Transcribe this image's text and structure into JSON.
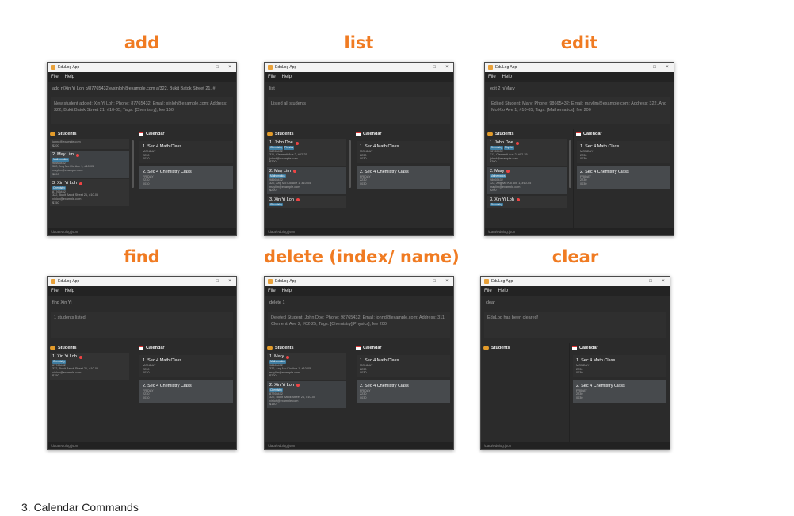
{
  "footer_text": "3. Calendar Commands",
  "accent_color": "#f07b22",
  "panels": [
    {
      "heading": "add",
      "window_title": "EduLog App",
      "menu": [
        "File",
        "Help"
      ],
      "command": "add n/Xin Yi Loh p/87765432 e/xinloh@example.com a/322, Bukit Batok Street 21, #",
      "result": "New student added: Xin Yi Loh; Phone: 87765432; Email: xinloh@example.com; Address: 322, Bukit Batok Street 21, #10-05; Tags: [Chemistry]; fee 150",
      "students_label": "Students",
      "calendar_label": "Calendar",
      "students": [
        {
          "partial": true,
          "lines": [
            "johnd@example.com",
            "$200"
          ]
        },
        {
          "name": "2. May Lim",
          "tags": [
            "Mathematics"
          ],
          "lines": [
            "98665432",
            "322, Ang Mo Kio Ave 1, #10-05",
            "maylim@example.com",
            "$200"
          ]
        },
        {
          "name": "3. Xin Yi Loh",
          "tags": [
            "Chemistry"
          ],
          "lines": [
            "87765432",
            "322, Bukit Batok Street 21, #10-05",
            "xinloh@example.com",
            "$150"
          ]
        }
      ],
      "classes": [
        {
          "name": "1. Sec 4 Math Class",
          "lines": [
            "MONDAY",
            "2230",
            "0030"
          ]
        },
        {
          "name": "2. Sec 4 Chemistry Class",
          "lines": [
            "FRIDAY",
            "2230",
            "0030"
          ]
        }
      ],
      "status": "\\data\\edulog.json"
    },
    {
      "heading": "list",
      "window_title": "EduLog App",
      "menu": [
        "File",
        "Help"
      ],
      "command": "list",
      "result": "Listed all students",
      "students_label": "Students",
      "calendar_label": "Calendar",
      "students": [
        {
          "name": "1. John Doe",
          "tags": [
            "Chemistry",
            "Physics"
          ],
          "lines": [
            "98765432",
            "311, Clementi Ave 2, #02-25",
            "johnd@example.com",
            "$200"
          ]
        },
        {
          "name": "2. May Lim",
          "tags": [
            "Mathematics"
          ],
          "lines": [
            "98665432",
            "322, Ang Mo Kio Ave 1, #10-05",
            "maylim@example.com",
            "$200"
          ]
        },
        {
          "name": "3. Xin Yi Loh",
          "tags": [
            "Chemistry"
          ],
          "lines": []
        }
      ],
      "classes": [
        {
          "name": "1. Sec 4 Math Class",
          "lines": [
            "MONDAY",
            "2230",
            "0030"
          ]
        },
        {
          "name": "2. Sec 4 Chemistry Class",
          "lines": [
            "FRIDAY",
            "2230",
            "0030"
          ]
        }
      ],
      "status": "\\data\\edulog.json"
    },
    {
      "heading": "edit",
      "window_title": "EduLog App",
      "menu": [
        "File",
        "Help"
      ],
      "command": "edit 2 n/Mary",
      "result": "Edited Student: Mary; Phone: 98665432; Email: maylim@example.com; Address: 322, Ang Mo Kio Ave 1, #10-05; Tags: [Mathematics]; fee 200",
      "students_label": "Students",
      "calendar_label": "Calendar",
      "students": [
        {
          "name": "1. John Doe",
          "tags": [
            "Chemistry",
            "Physics"
          ],
          "lines": [
            "98765432",
            "311, Clementi Ave 2, #02-25",
            "johnd@example.com",
            "$200"
          ]
        },
        {
          "name": "2. Mary",
          "tags": [
            "Mathematics"
          ],
          "lines": [
            "98665432",
            "322, Ang Mo Kio Ave 1, #10-05",
            "maylim@example.com",
            "$200"
          ]
        },
        {
          "name": "3. Xin Yi Loh",
          "tags": [
            "Chemistry"
          ],
          "lines": []
        }
      ],
      "classes": [
        {
          "name": "1. Sec 4 Math Class",
          "lines": [
            "MONDAY",
            "2230",
            "0030"
          ]
        },
        {
          "name": "2. Sec 4 Chemistry Class",
          "lines": [
            "FRIDAY",
            "2230",
            "0030"
          ]
        }
      ],
      "status": "\\data\\edulog.json"
    },
    {
      "heading": "find",
      "window_title": "EduLog App",
      "menu": [
        "File",
        "Help"
      ],
      "command": "find Xin Yi",
      "result": "1 students listed!",
      "students_label": "Students",
      "calendar_label": "Calendar",
      "students": [
        {
          "name": "1. Xin Yi Loh",
          "tags": [
            "Chemistry"
          ],
          "lines": [
            "87765432",
            "322, Bukit Batok Street 21, #10-05",
            "xinloh@example.com",
            "$150"
          ]
        }
      ],
      "classes": [
        {
          "name": "1. Sec 4 Math Class",
          "lines": [
            "MONDAY",
            "2230",
            "0030"
          ]
        },
        {
          "name": "2. Sec 4 Chemistry Class",
          "lines": [
            "FRIDAY",
            "2230",
            "0030"
          ]
        }
      ],
      "status": "\\data\\edulog.json"
    },
    {
      "heading": "delete (index/ name)",
      "window_title": "EduLog App",
      "menu": [
        "File",
        "Help"
      ],
      "command": "delete 1",
      "result": "Deleted Student: John Doe; Phone: 98765432; Email: johnd@example.com; Address: 311, Clementi Ave 2, #02-25; Tags: [Chemistry][Physics]; fee 200",
      "students_label": "Students",
      "calendar_label": "Calendar",
      "students": [
        {
          "name": "1. Mary",
          "tags": [
            "Mathematics"
          ],
          "lines": [
            "98665432",
            "322, Ang Mo Kio Ave 1, #10-05",
            "maylim@example.com",
            "$200"
          ]
        },
        {
          "name": "2. Xin Yi Loh",
          "tags": [
            "Chemistry"
          ],
          "lines": [
            "87765432",
            "322, Bukit Batok Street 21, #10-05",
            "xinloh@example.com",
            "$150"
          ]
        }
      ],
      "classes": [
        {
          "name": "1. Sec 4 Math Class",
          "lines": [
            "MONDAY",
            "2230",
            "0030"
          ]
        },
        {
          "name": "2. Sec 4 Chemistry Class",
          "lines": [
            "FRIDAY",
            "2230",
            "0030"
          ]
        }
      ],
      "status": "\\data\\edulog.json"
    },
    {
      "heading": "clear",
      "window_title": "EduLog App",
      "menu": [
        "File",
        "Help"
      ],
      "command": "clear",
      "result": "EduLog has been cleared!",
      "students_label": "Students",
      "calendar_label": "Calendar",
      "students": [],
      "classes": [
        {
          "name": "1. Sec 4 Math Class",
          "lines": [
            "MONDAY",
            "2230",
            "0030"
          ]
        },
        {
          "name": "2. Sec 4 Chemistry Class",
          "lines": [
            "FRIDAY",
            "2230",
            "0030"
          ]
        }
      ],
      "status": "\\data\\edulog.json"
    }
  ]
}
